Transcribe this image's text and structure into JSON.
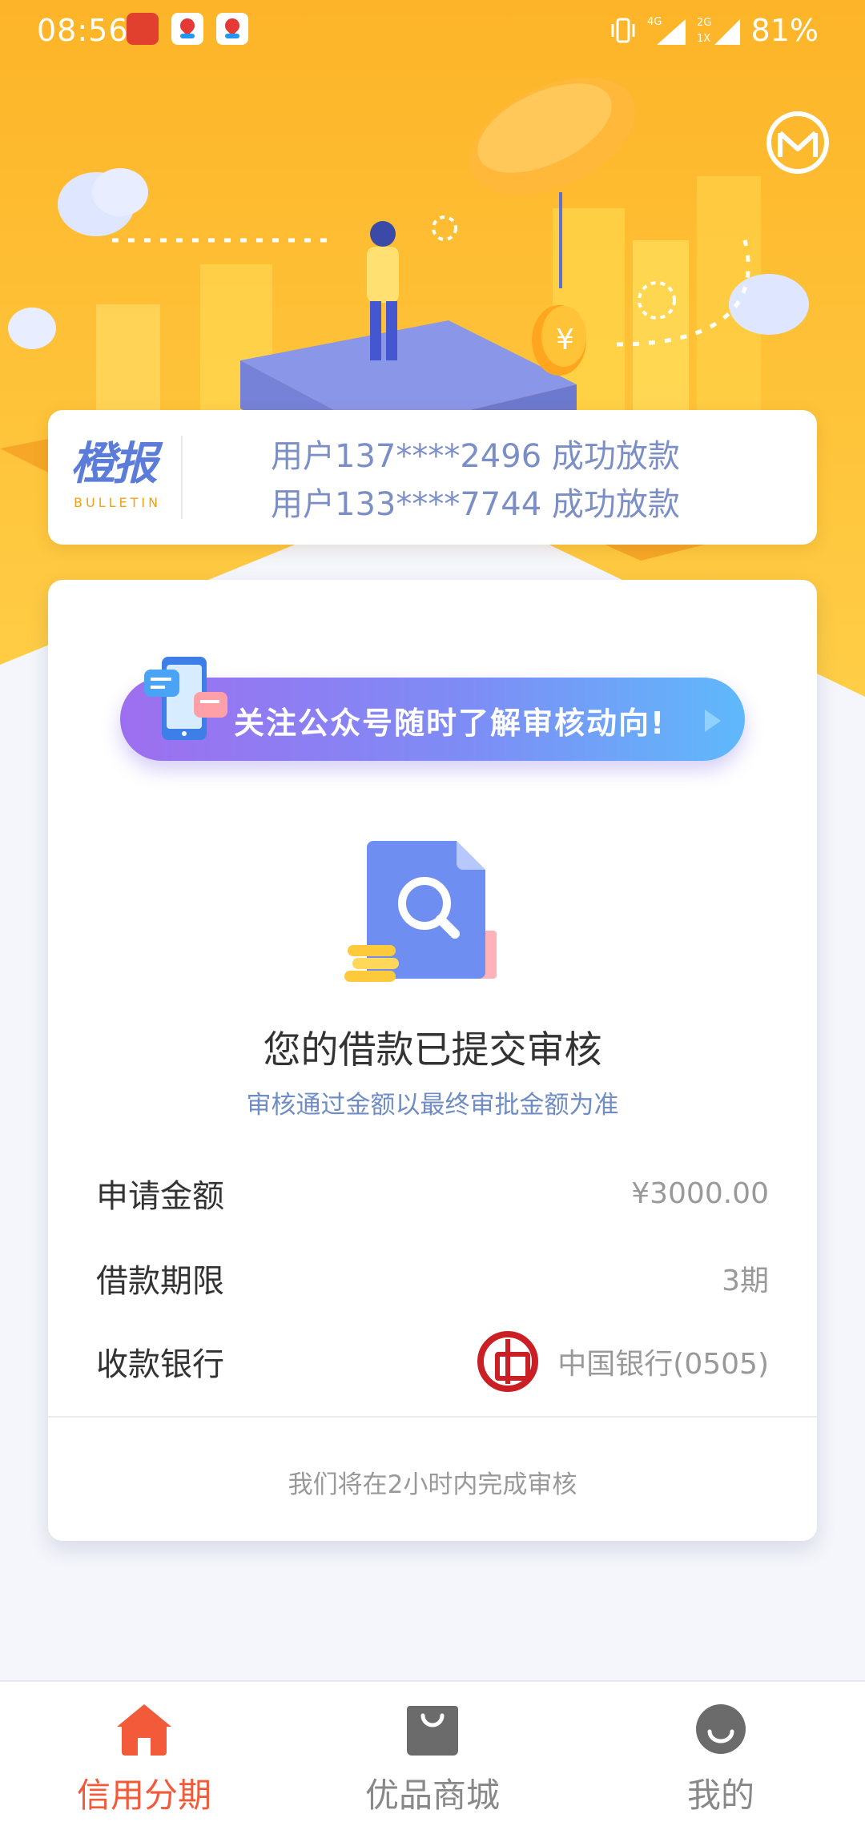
{
  "status_bar": {
    "time": "08:56",
    "network": "4G",
    "network_secondary": "2G",
    "sim_label": "1X",
    "battery": "81%"
  },
  "bulletin": {
    "logo_title": "橙报",
    "logo_subtitle": "BULLETIN",
    "items": [
      "用户137****2496 成功放款",
      "用户133****7744 成功放款"
    ]
  },
  "banner": {
    "text": "关注公众号随时了解审核动向!"
  },
  "review": {
    "title": "您的借款已提交审核",
    "subtitle": "审核通过金额以最终审批金额为准"
  },
  "details": [
    {
      "label": "申请金额",
      "value": "¥3000.00"
    },
    {
      "label": "借款期限",
      "value": "3期"
    },
    {
      "label": "收款银行",
      "value": "中国银行(0505)"
    }
  ],
  "footer_note": "我们将在2小时内完成审核",
  "tabs": [
    {
      "label": "信用分期",
      "icon": "home-icon",
      "active": true
    },
    {
      "label": "优品商城",
      "icon": "shopping-bag-icon",
      "active": false
    },
    {
      "label": "我的",
      "icon": "profile-icon",
      "active": false
    }
  ],
  "colors": {
    "accent": "#f25a39",
    "hero": "#fbb52a",
    "link_blue": "#6f8cc4",
    "bank_red": "#c91f25"
  }
}
